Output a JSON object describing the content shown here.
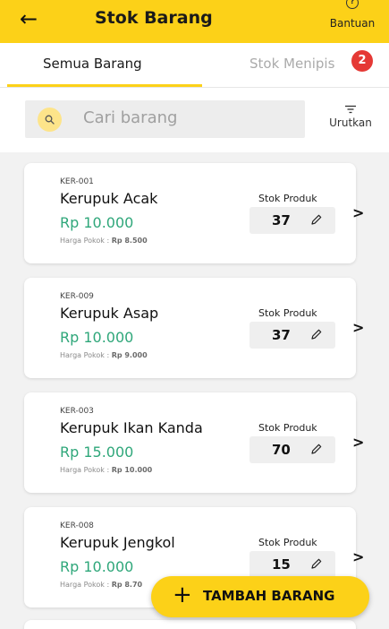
{
  "header": {
    "back_icon": "arrow-left-icon",
    "title": "Stok Barang",
    "help_icon": "question-circle-icon",
    "help_label": "Bantuan",
    "accent_color": "#fcd118"
  },
  "tabs": [
    {
      "label": "Semua Barang",
      "active": true
    },
    {
      "label": "Stok Menipis",
      "active": false,
      "badge": "2"
    }
  ],
  "search": {
    "icon": "search-icon",
    "placeholder": "Cari barang",
    "sort_icon": "sort-icon",
    "sort_label": "Urutkan"
  },
  "products": [
    {
      "code": "KER-001",
      "name": "Kerupuk Acak",
      "price": "Rp 10.000",
      "cost_label": "Harga Pokok : ",
      "cost": "Rp 8.500",
      "stock_label": "Stok Produk",
      "stock": "37"
    },
    {
      "code": "KER-009",
      "name": "Kerupuk Asap",
      "price": "Rp 10.000",
      "cost_label": "Harga Pokok : ",
      "cost": "Rp 9.000",
      "stock_label": "Stok Produk",
      "stock": "37"
    },
    {
      "code": "KER-003",
      "name": "Kerupuk Ikan Kanda",
      "price": "Rp 15.000",
      "cost_label": "Harga Pokok : ",
      "cost": "Rp 10.000",
      "stock_label": "Stok Produk",
      "stock": "70"
    },
    {
      "code": "KER-008",
      "name": "Kerupuk Jengkol",
      "price": "Rp 10.000",
      "cost_label": "Harga Pokok : ",
      "cost": "Rp 8.70",
      "stock_label": "Stok Produk",
      "stock": "15"
    }
  ],
  "fab": {
    "icon": "plus-icon",
    "label": "TAMBAH BARANG"
  },
  "colors": {
    "price": "#2fa77a",
    "badge": "#e53935"
  }
}
